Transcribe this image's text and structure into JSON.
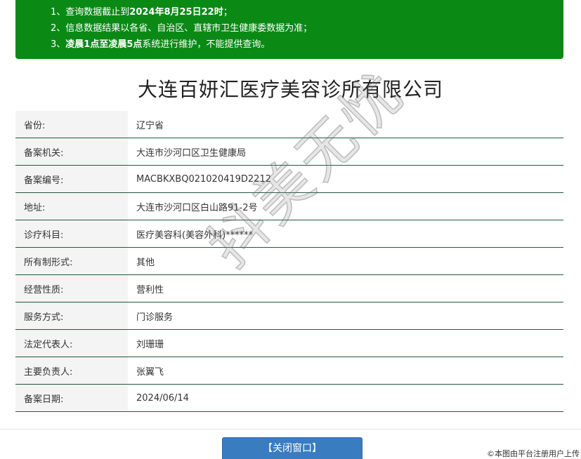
{
  "notice": {
    "line1_pre": "1、查询数据截止到",
    "line1_bold": "2024年8月25日22时",
    "line1_post": "；",
    "line2": "2、信息数据结果以各省、自治区、直辖市卫生健康委数据为准；",
    "line3_pre": "3、",
    "line3_bold": "凌晨1点至凌晨5点",
    "line3_post": "系统进行维护，不能提供查询。"
  },
  "title": "大连百妍汇医疗美容诊所有限公司",
  "rows": [
    {
      "label": "省份:",
      "value": "辽宁省"
    },
    {
      "label": "备案机关:",
      "value": "大连市沙河口区卫生健康局"
    },
    {
      "label": "备案编号:",
      "value": "MACBKXBQ021020419D2212"
    },
    {
      "label": "地址:",
      "value": "大连市沙河口区白山路91-2号"
    },
    {
      "label": "诊疗科目:",
      "value": "医疗美容科(美容外科)******"
    },
    {
      "label": "所有制形式:",
      "value": "其他"
    },
    {
      "label": "经营性质:",
      "value": "营利性"
    },
    {
      "label": "服务方式:",
      "value": "门诊服务"
    },
    {
      "label": "法定代表人:",
      "value": "刘珊珊"
    },
    {
      "label": "主要负责人:",
      "value": "张翼飞"
    },
    {
      "label": "备案日期:",
      "value": "2024/06/14"
    }
  ],
  "watermark": "抖美无忧",
  "close_button": "【关闭窗口】",
  "credit": "©本图由平台注册用户上传",
  "colors": {
    "notice_bg": "#0a8a15",
    "row_border": "#1f5a3e",
    "button_bg": "#3a7cc0"
  }
}
